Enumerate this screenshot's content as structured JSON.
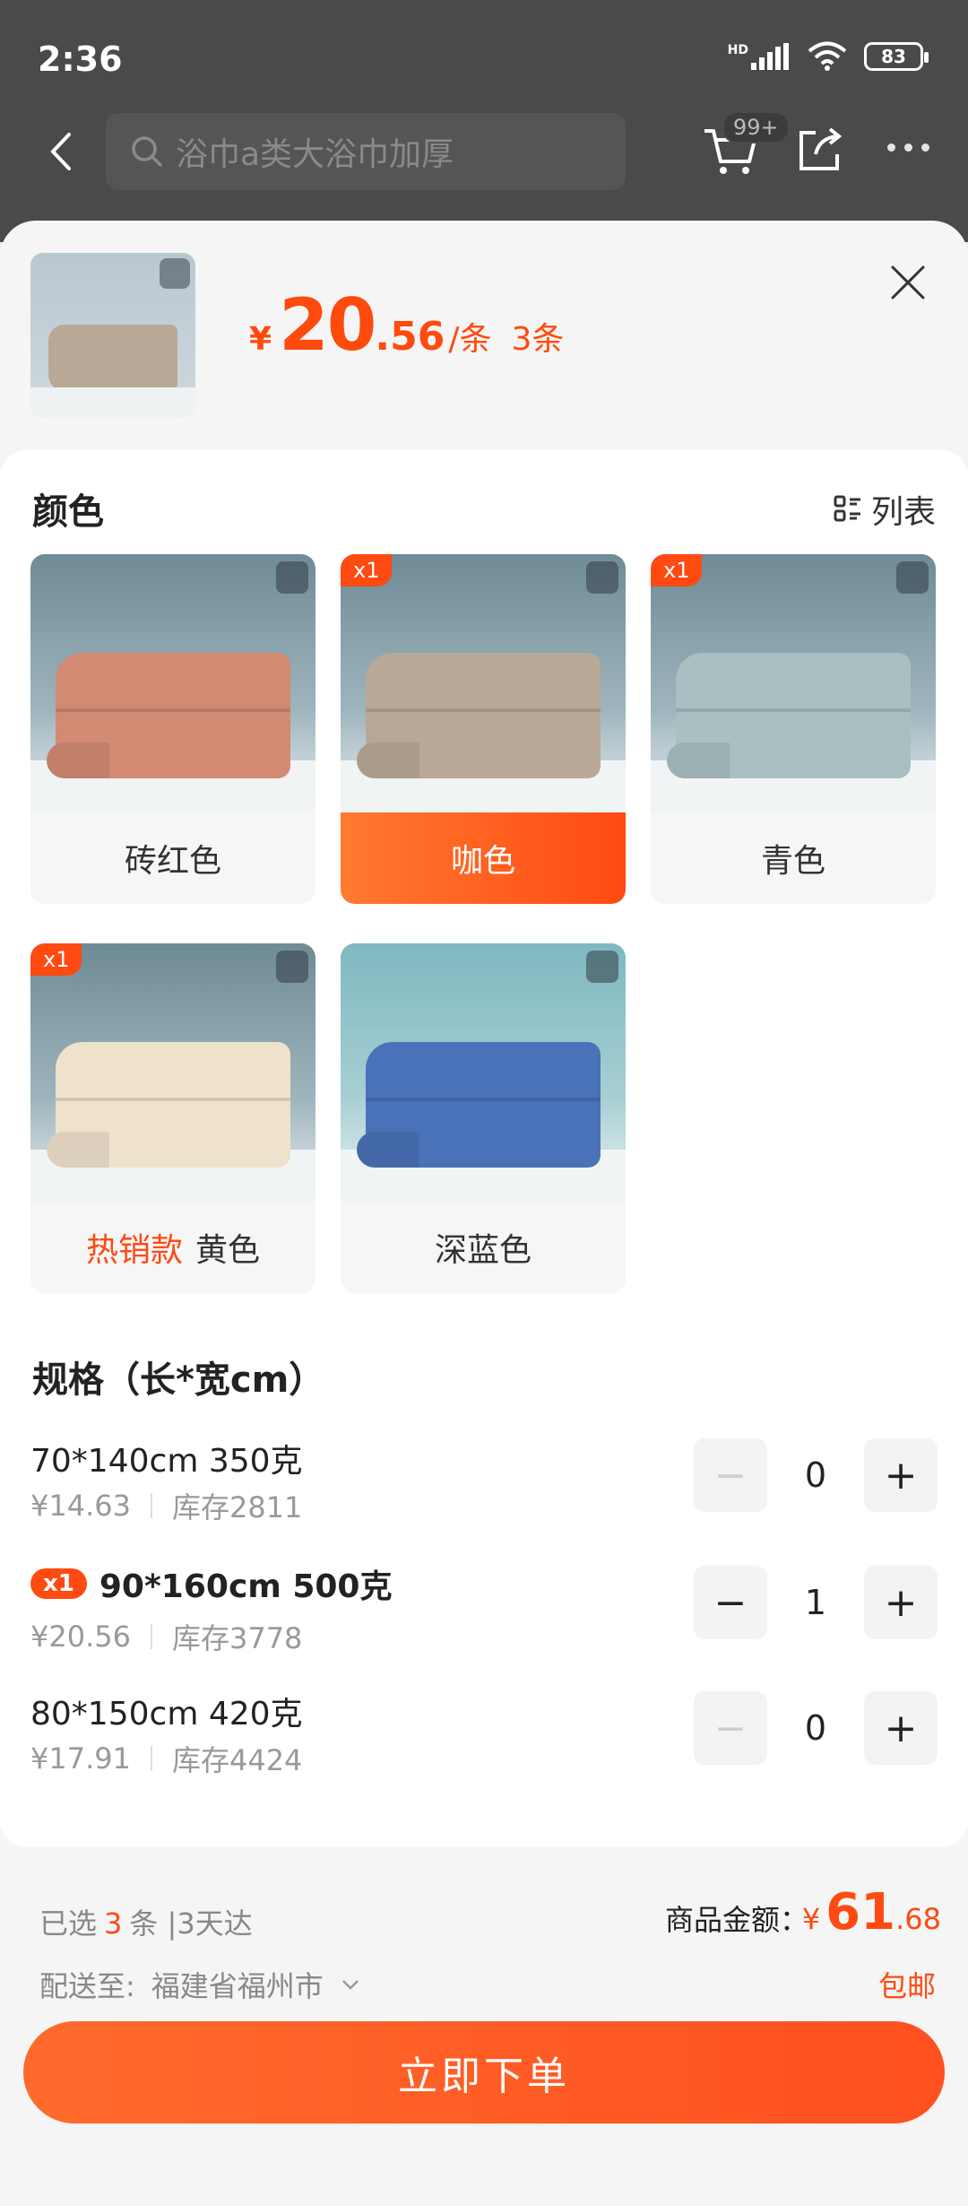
{
  "status_bar": {
    "time": "2:36",
    "network": "HD",
    "battery": "83"
  },
  "nav": {
    "search_placeholder": "浴巾a类大浴巾加厚",
    "cart_badge": "99+"
  },
  "header": {
    "price_symbol": "¥",
    "price_int": "20",
    "price_dec": ".56",
    "price_unit": "/条",
    "quantity": "3条"
  },
  "colors": {
    "title": "颜色",
    "list_label": "列表",
    "options": [
      {
        "name": "砖红色",
        "badge": "",
        "tag": "",
        "towel_color": "#d28a72",
        "selected": false
      },
      {
        "name": "咖色",
        "badge": "x1",
        "tag": "",
        "towel_color": "#b9a896",
        "selected": true
      },
      {
        "name": "青色",
        "badge": "x1",
        "tag": "",
        "towel_color": "#a9bfc2",
        "selected": false
      },
      {
        "name": "黄色",
        "badge": "x1",
        "tag": "热销款",
        "towel_color": "#efe2cc",
        "selected": false
      },
      {
        "name": "深蓝色",
        "badge": "",
        "tag": "",
        "towel_color": "#4a72b8",
        "selected": false
      }
    ]
  },
  "specs": {
    "title": "规格（长*宽cm）",
    "items": [
      {
        "name": "70*140cm 350克",
        "badge": "",
        "price": "¥14.63",
        "stock": "库存2811",
        "qty": "0",
        "bold": false
      },
      {
        "name": "90*160cm 500克",
        "badge": "x1",
        "price": "¥20.56",
        "stock": "库存3778",
        "qty": "1",
        "bold": true
      },
      {
        "name": "80*150cm 420克",
        "badge": "",
        "price": "¥17.91",
        "stock": "库存4424",
        "qty": "0",
        "bold": false
      }
    ]
  },
  "footer": {
    "selected_prefix": "已选",
    "selected_count": "3",
    "selected_suffix": "条 |3天达",
    "amount_label": "商品金额：",
    "amount_symbol": "¥",
    "amount_int": "61",
    "amount_dec": ".68",
    "ship_label": "配送至:",
    "ship_address": "福建省福州市",
    "free_shipping": "包邮",
    "order_button": "立即下单"
  },
  "theme": {
    "accent": "#ff4a12",
    "sheet_bg": "#f5f5f5"
  }
}
